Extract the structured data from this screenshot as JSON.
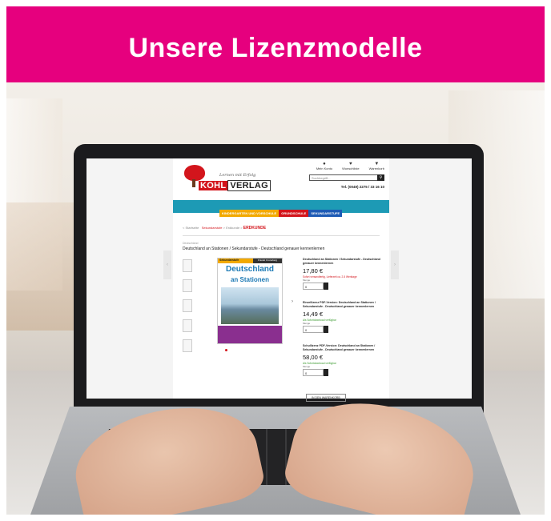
{
  "banner": {
    "title": "Unsere Lizenzmodelle"
  },
  "website": {
    "account_icons": [
      {
        "icon": "user-icon",
        "label": "Mein Konto"
      },
      {
        "icon": "heart-icon",
        "label": "Wunschliste"
      },
      {
        "icon": "cart-icon",
        "label": "Warenkorb"
      }
    ],
    "search_placeholder": "Suchbegriff...",
    "phone": "Tel. (0049) 2275 / 33 16 10",
    "logo": {
      "tagline": "Lernen mit Erfolg",
      "brand_first": "KOHL",
      "brand_second": "VERLAG"
    },
    "categories": [
      "KINDERGARTEN UND VORSCHULE",
      "GRUNDSCHULE",
      "SEKUNDARSTUFE"
    ],
    "breadcrumb": {
      "home": "Startseite",
      "level1": "Sekundarstufe",
      "level2": "Erdkunde",
      "current": "ERDKUNDE"
    },
    "product_subtitle": "Deutschland",
    "product_title": "Deutschland an Stationen / Sekundarstufe - Deutschland genauer kennenlernen",
    "cover": {
      "band": "Sekundarstufe",
      "author": "Friedel Croneberg",
      "title_line1": "Deutschland",
      "title_line2": "an Stationen"
    },
    "options": [
      {
        "name": "Deutschland an Stationen / Sekundarstufe - Deutschland genauer kennenlernen",
        "price": "17,80 €",
        "note": "Sofort versandfertig, Lieferzeit ca. 2-5 Werktage",
        "note_color": "red",
        "qty_label": "Menge",
        "qty": "0"
      },
      {
        "name": "Einzellizenz PDF-Version: Deutschland an Stationen / Sekundarstufe - Deutschland genauer kennenlernen",
        "price": "14,49 €",
        "note": "Als Sofortdownload verfügbar",
        "note_color": "green",
        "qty_label": "Menge",
        "qty": "0"
      },
      {
        "name": "Schullizenz PDF-Version: Deutschland an Stationen / Sekundarstufe - Deutschland genauer kennenlernen",
        "price": "58,00 €",
        "note": "Als Sofortdownload verfügbar",
        "note_color": "green",
        "qty_label": "Menge",
        "qty": "0"
      }
    ],
    "cart_button": "IN DEN WARENKORB"
  },
  "colors": {
    "banner": "#e6007e",
    "teal": "#1d9ab5",
    "brand_red": "#d3151c"
  }
}
